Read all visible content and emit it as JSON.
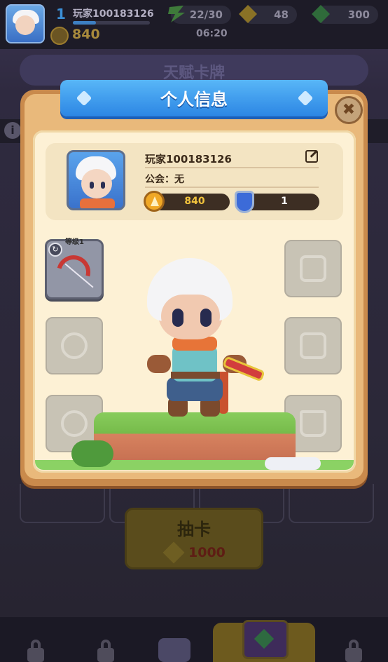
{
  "player": {
    "level": "1",
    "name": "玩家100183126",
    "trophies": "840",
    "guild_label": "公会：无",
    "rank": "1"
  },
  "resources": {
    "energy": "22/30",
    "gold": "48",
    "gems": "300",
    "timer": "06:20"
  },
  "background": {
    "banner_title": "天赋卡牌",
    "draw_button_label": "抽卡",
    "draw_cost": "1000"
  },
  "modal": {
    "title": "个人信息",
    "close_icon": "close-icon",
    "weapon_level": "等级1"
  },
  "icons": {
    "edit": "edit-icon",
    "trophy": "trophy-icon",
    "shield": "shield-icon",
    "lock": "lock-icon"
  },
  "colors": {
    "title_ribbon": "#2c86e4",
    "panel": "#fdf1d5",
    "modal_frame": "#c98a4c",
    "stat_text_gold": "#f3c43d",
    "stat_text_white": "#ffffff"
  }
}
